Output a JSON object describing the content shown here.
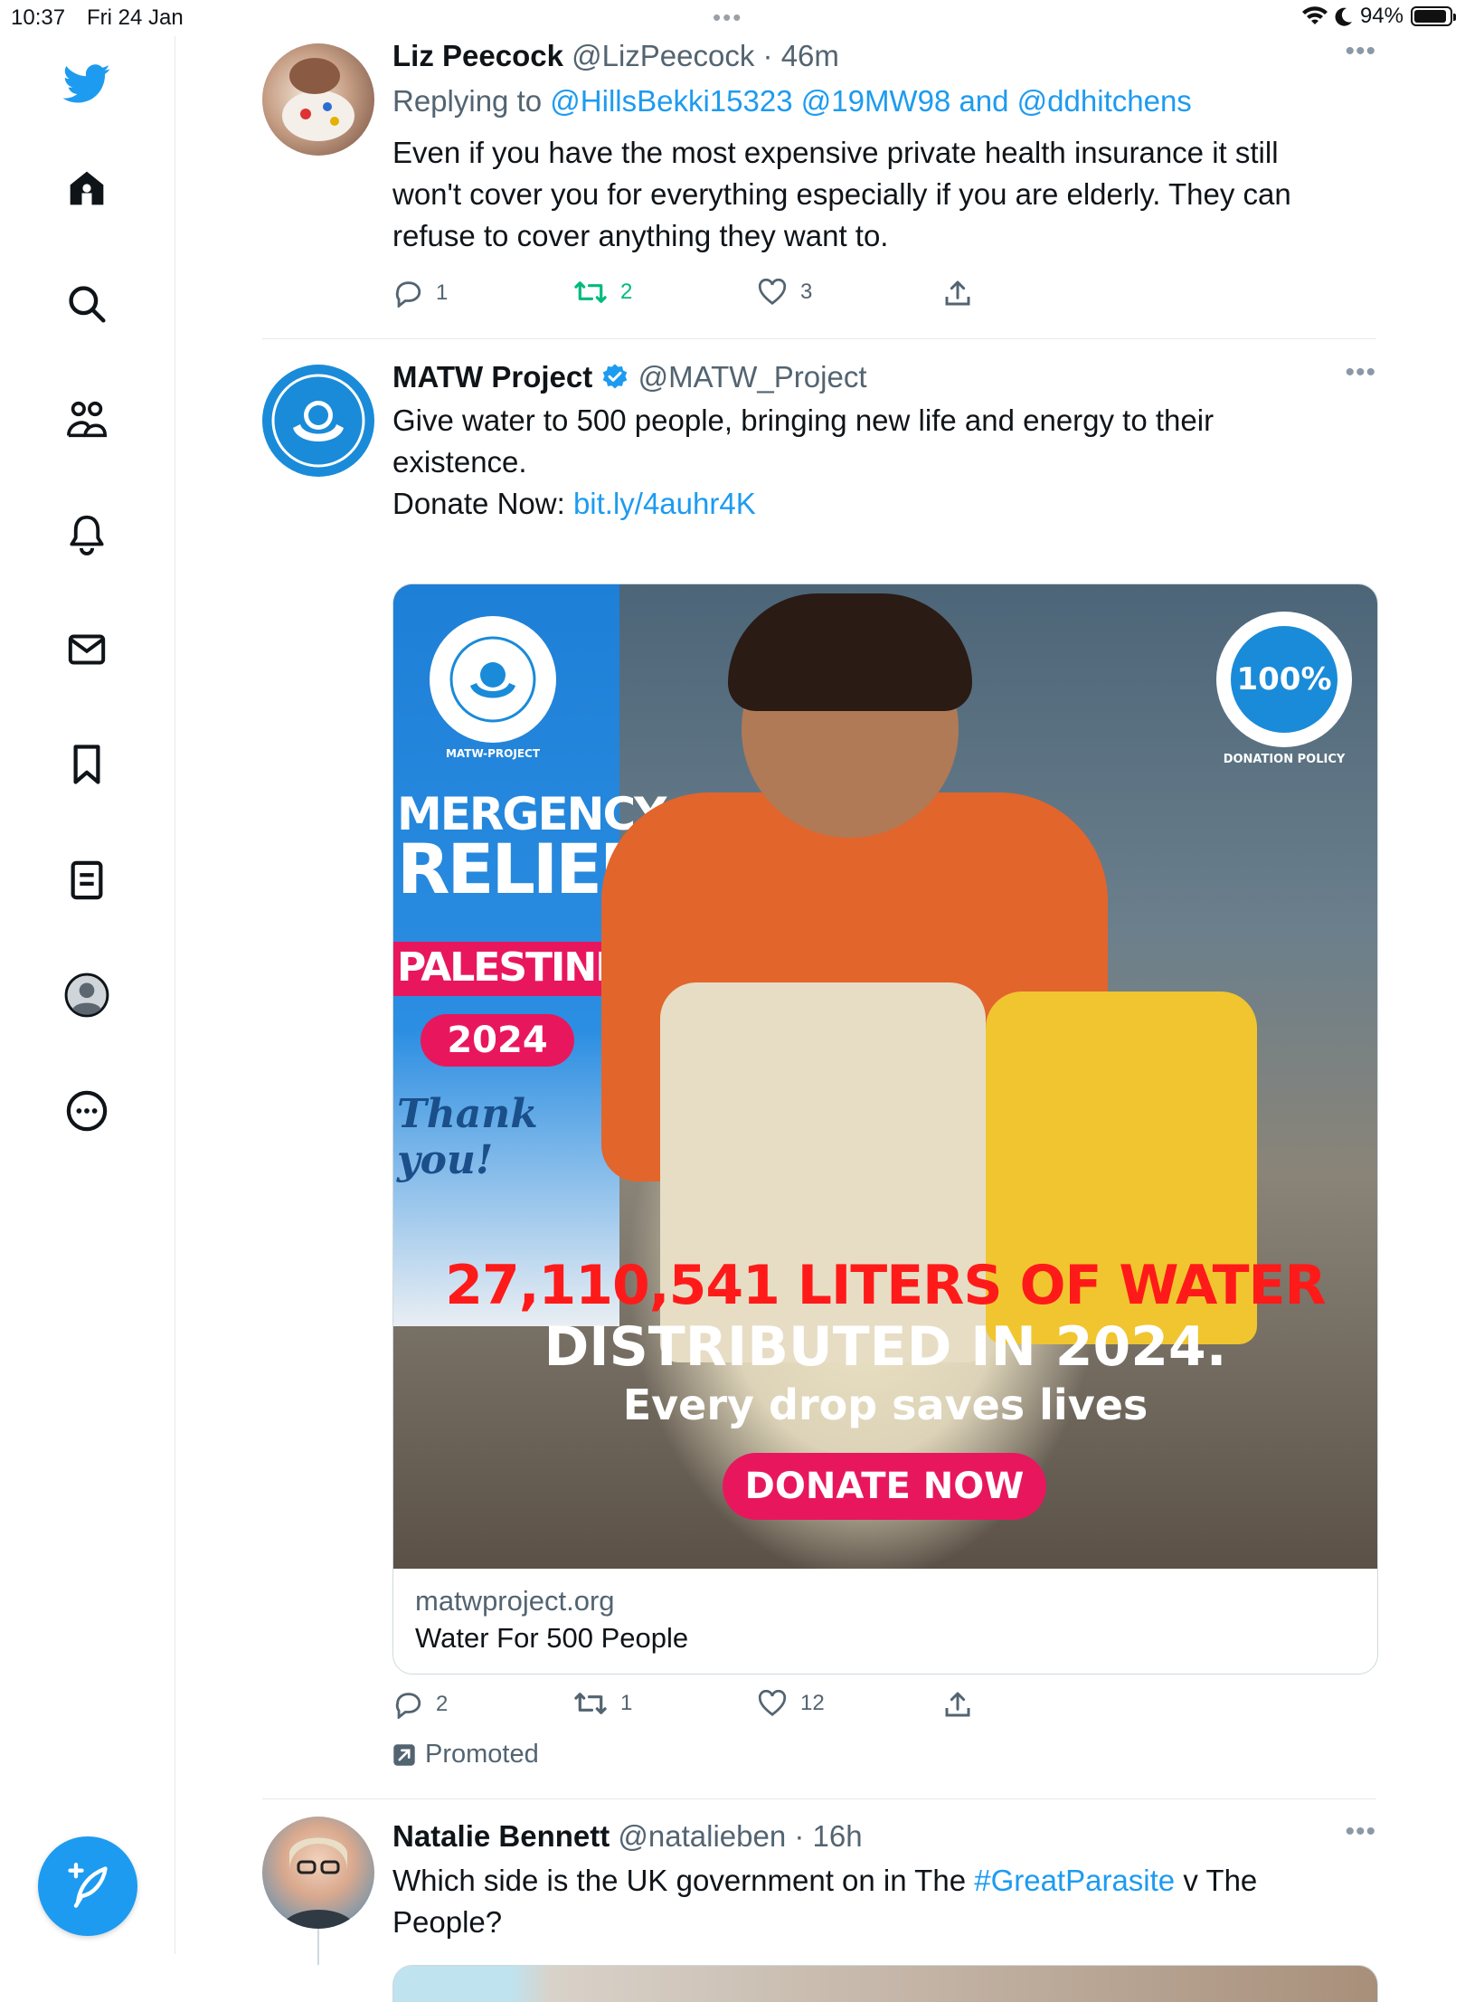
{
  "status_bar": {
    "time": "10:37",
    "date": "Fri 24 Jan",
    "battery": "94%",
    "battery_level": 0.94
  },
  "sidebar": {
    "items": [
      {
        "name": "twitter-logo"
      },
      {
        "name": "home-icon"
      },
      {
        "name": "search-icon"
      },
      {
        "name": "communities-icon"
      },
      {
        "name": "notifications-icon"
      },
      {
        "name": "messages-icon"
      },
      {
        "name": "bookmarks-icon"
      },
      {
        "name": "lists-icon"
      },
      {
        "name": "profile-icon"
      },
      {
        "name": "more-icon"
      }
    ],
    "compose_icon": "compose-tweet-icon"
  },
  "tweets": [
    {
      "name": "Liz Peecock",
      "handle": "@LizPeecock",
      "time": "· 46m",
      "replying_label": "Replying to",
      "replying_to": "@HillsBekki15323 @19MW98 and @ddhitchens",
      "text": "Even if you have the most expensive private health insurance it still won't cover you for everything especially if you are elderly.   They can refuse to cover anything they want to.",
      "replies": "1",
      "retweets": "2",
      "likes": "3"
    },
    {
      "name": "MATW Project",
      "handle": "@MATW_Project",
      "text_line": "Give water to 500 people, bringing new life and energy to their existence.",
      "donate_label": "Donate Now:",
      "donate_link": "bit.ly/4auhr4K",
      "card": {
        "banner_line1": "MERGENCY",
        "banner_line2": "RELIEF",
        "banner_line3": "PALESTINE",
        "banner_year": "2024",
        "banner_thanks": "Thank you!",
        "logo_text": "MATW-PROJECT",
        "badge_text": "100%",
        "badge_caption": "DONATION POLICY",
        "headline": "27,110,541 LITERS OF WATER",
        "subheadline": "DISTRIBUTED IN 2024.",
        "tagline": "Every drop saves lives",
        "button": "DONATE NOW",
        "domain": "matwproject.org",
        "title": "Water For 500 People"
      },
      "replies": "2",
      "retweets": "1",
      "likes": "12",
      "promoted": "Promoted"
    },
    {
      "name": "Natalie Bennett",
      "handle": "@natalieben",
      "time": "· 16h",
      "text_before": "Which side is the UK government on in The ",
      "hashtag": "#GreatParasite",
      "text_after": " v The People?"
    }
  ],
  "colors": {
    "accent": "#1d9bf0",
    "retweet_green": "#00ba7c",
    "promo_pink": "#e8175d",
    "headline_red": "#ff1a1a"
  }
}
